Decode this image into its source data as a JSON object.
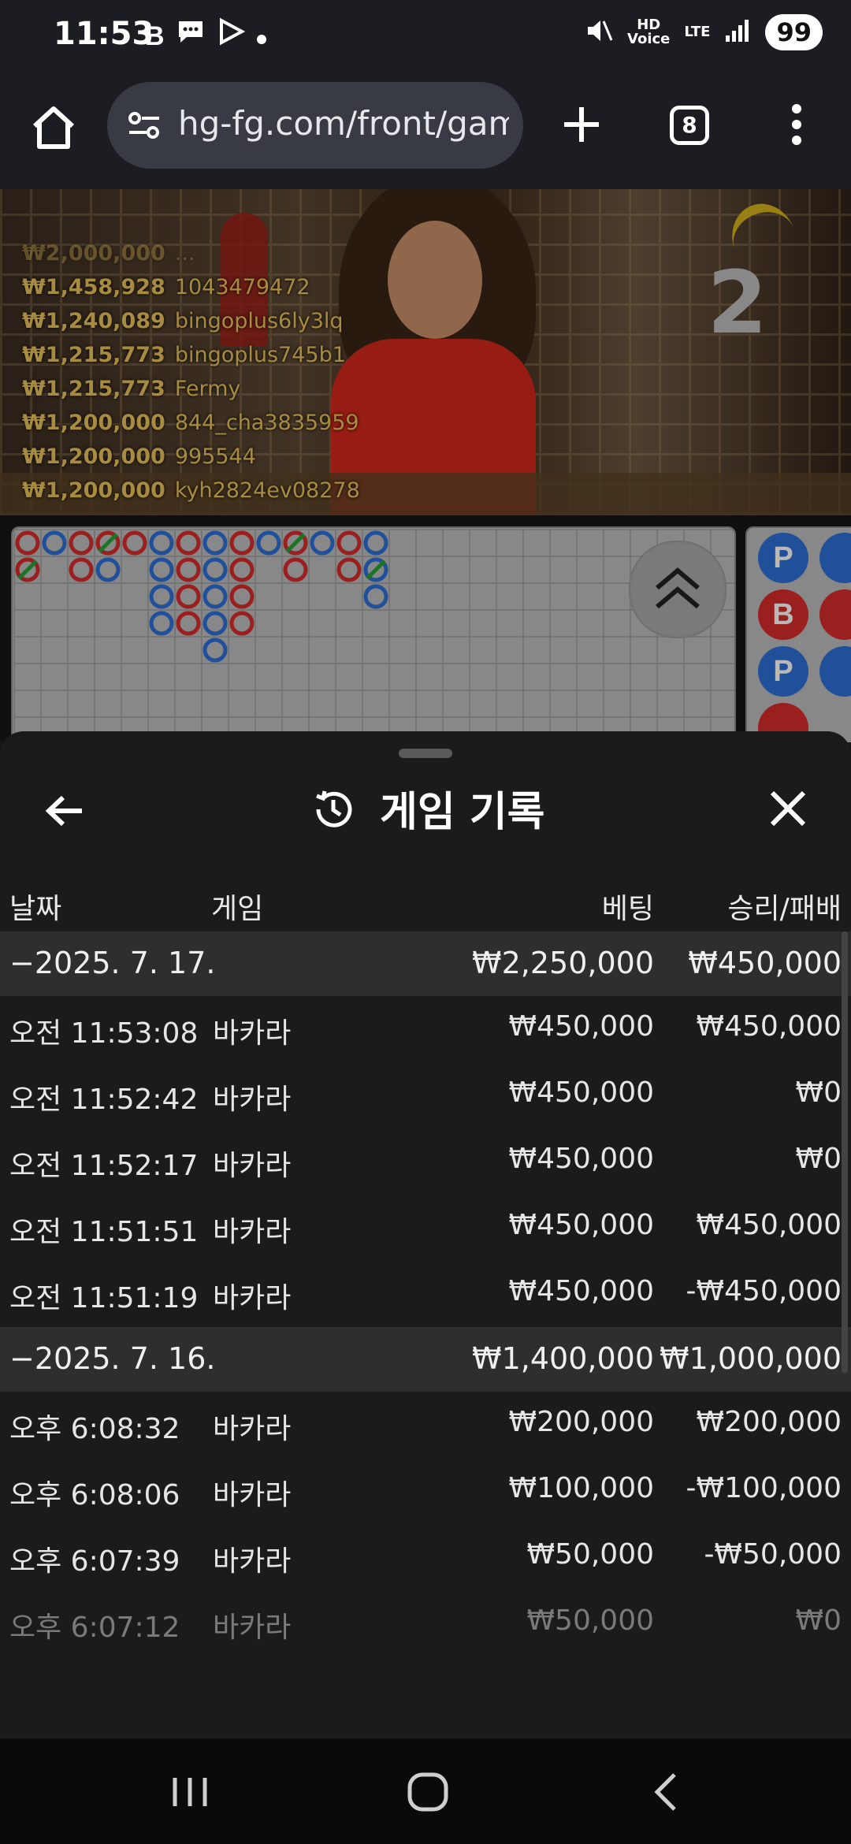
{
  "status_bar": {
    "time": "11:53",
    "notif_icons": [
      "b-app-icon",
      "chat-icon",
      "play-icon",
      "dot-icon"
    ],
    "hd_voice": "HD\nVoice",
    "lte": "LTE",
    "battery": "99"
  },
  "browser": {
    "url": "hg-fg.com/front/gam",
    "tab_count": "8"
  },
  "video": {
    "round_number": "2",
    "winners": [
      {
        "amount": "₩2,000,000",
        "name": "..."
      },
      {
        "amount": "₩1,458,928",
        "name": "1043479472"
      },
      {
        "amount": "₩1,240,089",
        "name": "bingoplus6ly3lq"
      },
      {
        "amount": "₩1,215,773",
        "name": "bingoplus745b1"
      },
      {
        "amount": "₩1,215,773",
        "name": "Fermy"
      },
      {
        "amount": "₩1,200,000",
        "name": "844_cha3835959"
      },
      {
        "amount": "₩1,200,000",
        "name": "995544"
      },
      {
        "amount": "₩1,200,000",
        "name": "kyh2824ev08278"
      }
    ]
  },
  "bead_road": [
    "P",
    "B",
    "P"
  ],
  "colors": {
    "banker": "#d62b2b",
    "player": "#2f6fd6",
    "tie": "#2e9e3a"
  },
  "sheet": {
    "title": "게임 기록",
    "headers": {
      "date": "날짜",
      "game": "게임",
      "bet": "베팅",
      "win": "승리/패배"
    },
    "rows": [
      {
        "type": "group",
        "date": "−2025. 7. 17.",
        "game": "",
        "bet": "₩2,250,000",
        "win": "₩450,000"
      },
      {
        "type": "item",
        "date": "오전 11:53:08",
        "game": "바카라",
        "bet": "₩450,000",
        "win": "₩450,000"
      },
      {
        "type": "item",
        "date": "오전 11:52:42",
        "game": "바카라",
        "bet": "₩450,000",
        "win": "₩0"
      },
      {
        "type": "item",
        "date": "오전 11:52:17",
        "game": "바카라",
        "bet": "₩450,000",
        "win": "₩0"
      },
      {
        "type": "item",
        "date": "오전 11:51:51",
        "game": "바카라",
        "bet": "₩450,000",
        "win": "₩450,000"
      },
      {
        "type": "item",
        "date": "오전 11:51:19",
        "game": "바카라",
        "bet": "₩450,000",
        "win": "-₩450,000"
      },
      {
        "type": "group",
        "date": "−2025. 7. 16.",
        "game": "",
        "bet": "₩1,400,000",
        "win": "₩1,000,000"
      },
      {
        "type": "item",
        "date": "오후 6:08:32",
        "game": "바카라",
        "bet": "₩200,000",
        "win": "₩200,000"
      },
      {
        "type": "item",
        "date": "오후 6:08:06",
        "game": "바카라",
        "bet": "₩100,000",
        "win": "-₩100,000"
      },
      {
        "type": "item",
        "date": "오후 6:07:39",
        "game": "바카라",
        "bet": "₩50,000",
        "win": "-₩50,000"
      },
      {
        "type": "faded",
        "date": "오후 6:07:12",
        "game": "바카라",
        "bet": "₩50,000",
        "win": "₩0"
      }
    ]
  }
}
